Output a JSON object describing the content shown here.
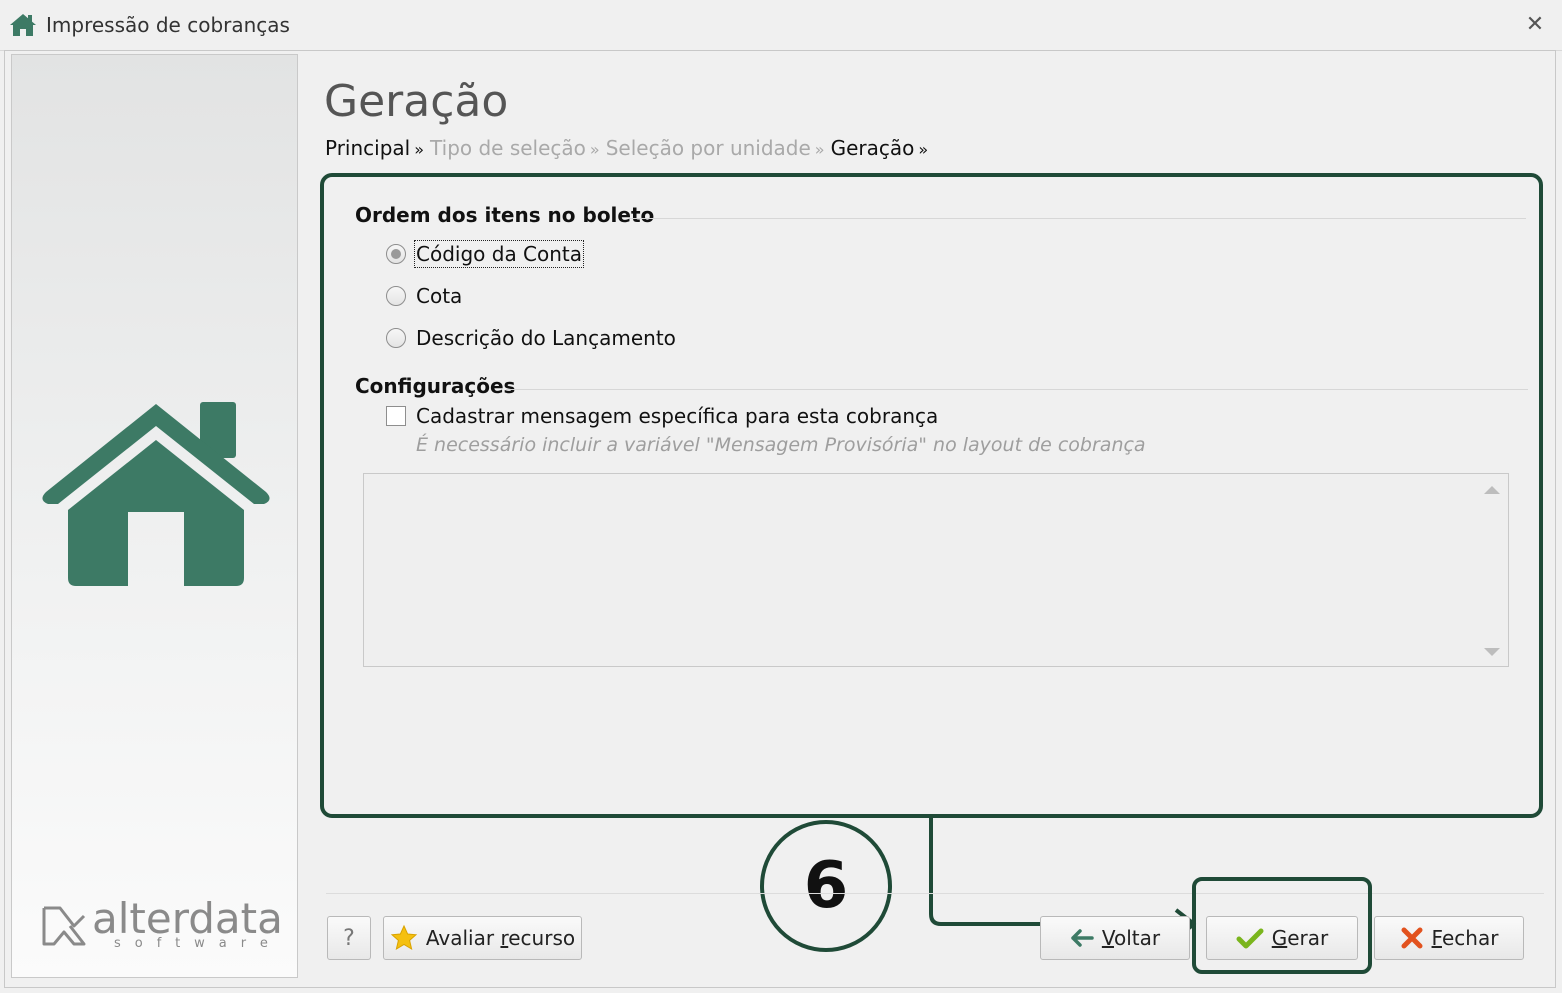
{
  "window": {
    "title": "Impressão de cobranças",
    "close_symbol": "✕"
  },
  "sidebar": {
    "logo_text": "alterdata",
    "logo_subtext": "software"
  },
  "page": {
    "title": "Geração"
  },
  "breadcrumb": [
    {
      "label": "Principal",
      "state": "active"
    },
    {
      "label": "Tipo de seleção",
      "state": "inactive"
    },
    {
      "label": "Seleção por unidade",
      "state": "inactive"
    },
    {
      "label": "Geração",
      "state": "active"
    }
  ],
  "breadcrumb_separator": "»",
  "order_group": {
    "title": "Ordem dos itens no boleto",
    "options": [
      {
        "label": "Código da Conta",
        "checked": true
      },
      {
        "label": "Cota",
        "checked": false
      },
      {
        "label": "Descrição do Lançamento",
        "checked": false
      }
    ]
  },
  "config_group": {
    "title": "Configurações",
    "checkbox_label": "Cadastrar mensagem específica para esta cobrança",
    "checkbox_checked": false,
    "hint": "É necessário incluir a variável \"Mensagem Provisória\" no layout de cobrança",
    "message_value": ""
  },
  "annotation": {
    "step_number": "6",
    "color": "#1f4a37"
  },
  "buttons": {
    "help": "?",
    "rate": {
      "prefix": "Avaliar ",
      "accel": "r",
      "suffix": "ecurso"
    },
    "back": {
      "accel": "V",
      "suffix": "oltar"
    },
    "generate": {
      "accel": "G",
      "suffix": "erar"
    },
    "close": {
      "accel": "F",
      "suffix": "echar"
    }
  },
  "icons": {
    "app": "home-icon",
    "sidebar": "house-icon",
    "rate": "star-icon",
    "back": "arrow-left-icon",
    "generate": "checkmark-icon",
    "close": "x-icon"
  },
  "colors": {
    "brand_green": "#3d7a65",
    "annotation": "#1f4a37"
  }
}
